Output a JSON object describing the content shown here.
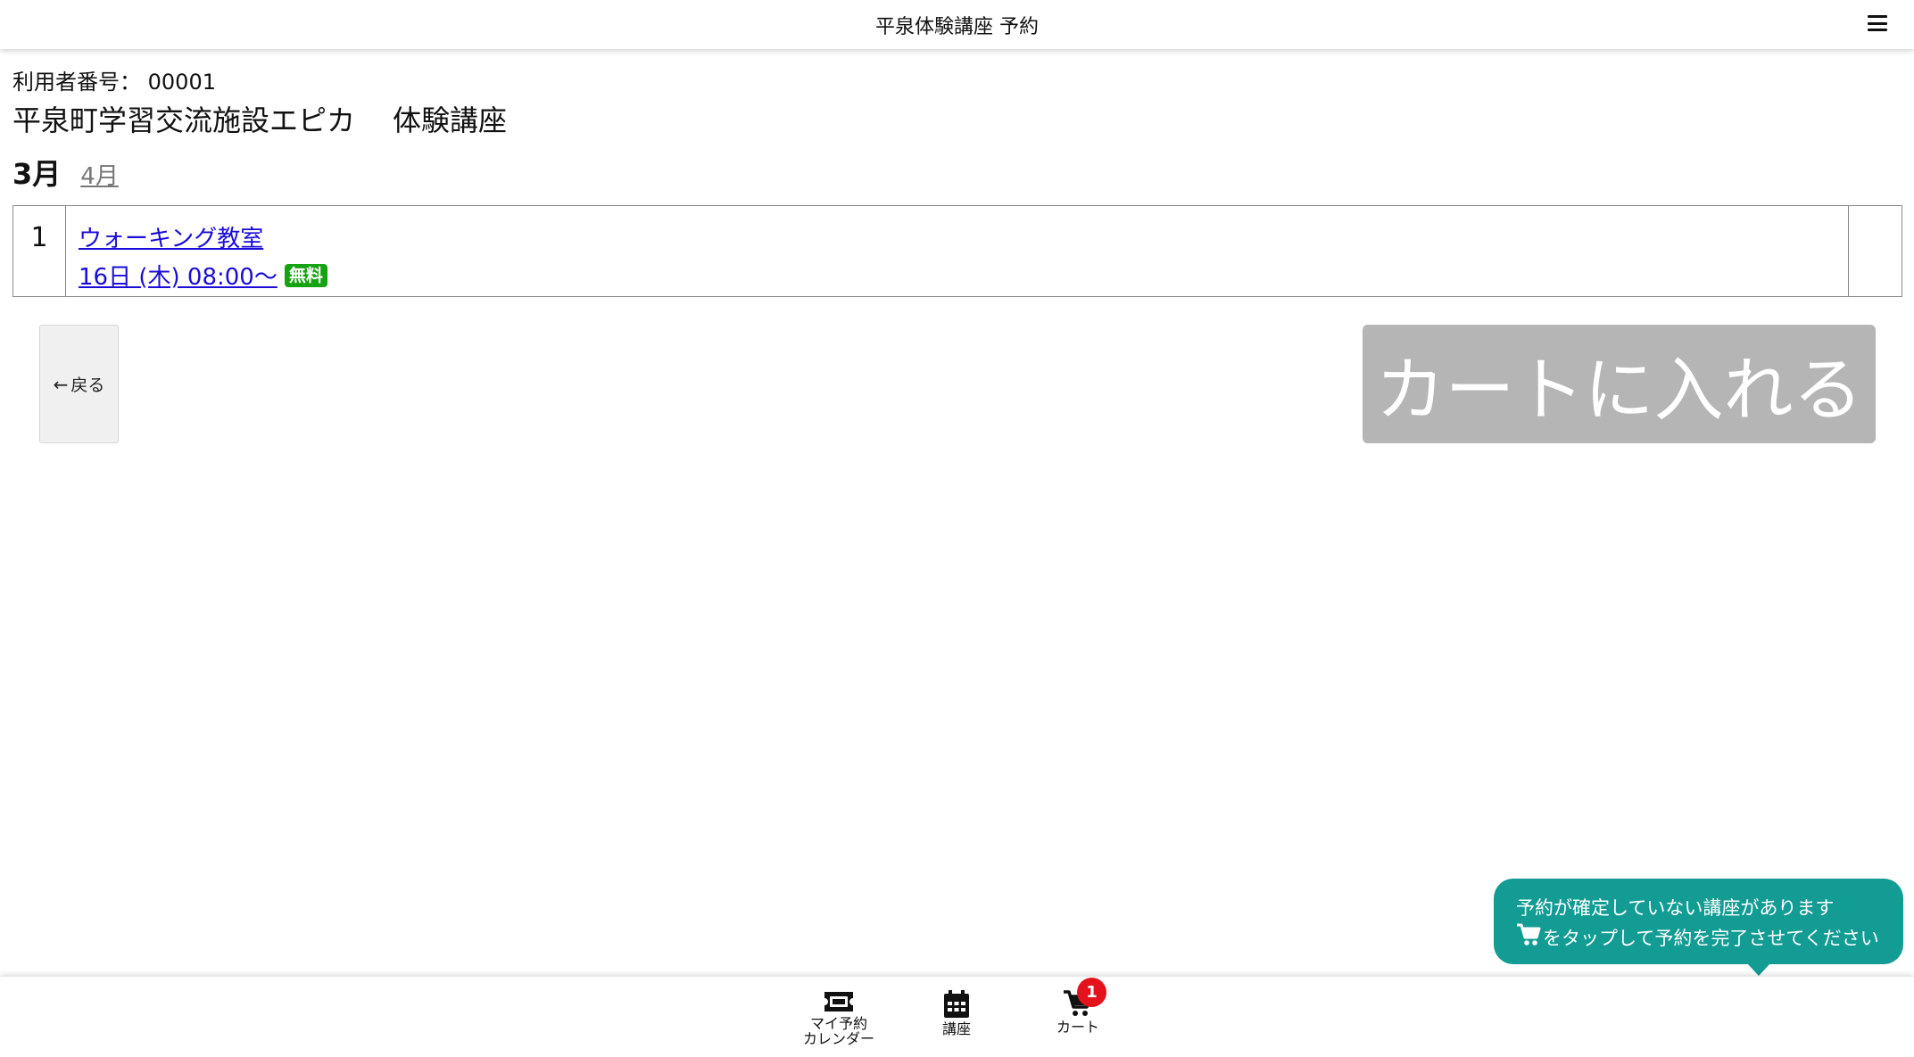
{
  "header": {
    "title": "平泉体験講座 予約",
    "menu_icon": "hamburger-menu-icon"
  },
  "user": {
    "label": "利用者番号：",
    "number": "00001"
  },
  "facility": {
    "name": "平泉町学習交流施設エピカ",
    "category": "体験講座"
  },
  "months": {
    "current": "3月",
    "next": "4月"
  },
  "courses": [
    {
      "number": "1",
      "title": "ウォーキング教室",
      "datetime": "16日 (木) 08:00〜",
      "badge": "無料"
    }
  ],
  "buttons": {
    "back": "戻る",
    "add_to_cart": "カートに入れる"
  },
  "notice": {
    "line1": "予約が確定していない講座があります",
    "line2": "をタップして予約を完了させてください"
  },
  "bottom_nav": {
    "my_reservation_line1": "マイ予約",
    "my_reservation_line2": "カレンダー",
    "courses": "講座",
    "cart": "カート",
    "cart_count": "1"
  },
  "colors": {
    "link": "#1a0dd8",
    "free_badge": "#16a312",
    "notice_bg": "#129c94",
    "disabled_button": "#b5b5b5",
    "cart_badge": "#e3121d"
  }
}
